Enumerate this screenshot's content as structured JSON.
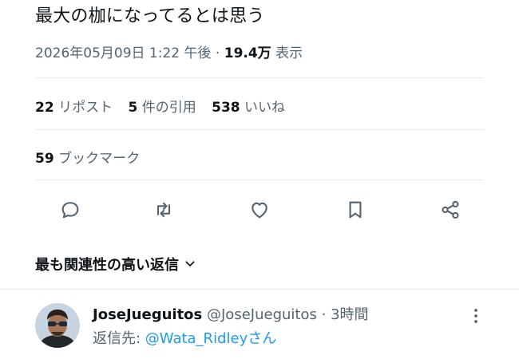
{
  "tweet": {
    "text": "最大の枷になってるとは思う",
    "timestamp": "2026年05月09日 1:22 午後",
    "separator": "·",
    "views_count": "19.4万",
    "views_label": "表示"
  },
  "stats": {
    "reposts_count": "22",
    "reposts_label": "リポスト",
    "quotes_count": "5",
    "quotes_label": "件の引用",
    "likes_count": "538",
    "likes_label": "いいね",
    "bookmarks_count": "59",
    "bookmarks_label": "ブックマーク"
  },
  "actions": [
    "reply-icon",
    "repost-icon",
    "like-icon",
    "bookmark-icon",
    "share-icon"
  ],
  "replies": {
    "sort_label": "最も関連性の高い返信",
    "first_reply": {
      "display_name": "JoseJueguitos",
      "handle": "@JoseJueguitos",
      "separator": "·",
      "time": "3時間",
      "reply_to_label": "返信先: ",
      "reply_to_mention": "@Wata_Ridley",
      "reply_to_suffix": "さん"
    }
  },
  "colors": {
    "accent": "#1d9bf0",
    "muted": "#536471",
    "text": "#0f1419",
    "divider": "#e7e9ea"
  }
}
